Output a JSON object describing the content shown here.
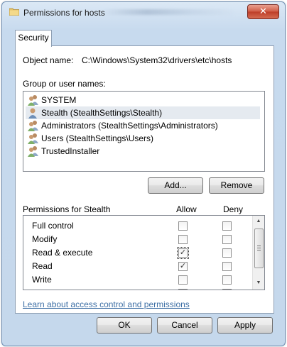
{
  "window": {
    "title": "Permissions for hosts",
    "close_glyph": "✕"
  },
  "tab": {
    "label": "Security"
  },
  "object": {
    "label": "Object name:",
    "value": "C:\\Windows\\System32\\drivers\\etc\\hosts"
  },
  "groups": {
    "label": "Group or user names:",
    "items": [
      {
        "label": "SYSTEM",
        "icon": "group-icon"
      },
      {
        "label": "Stealth (StealthSettings\\Stealth)",
        "icon": "user-icon",
        "selected": true
      },
      {
        "label": "Administrators (StealthSettings\\Administrators)",
        "icon": "group-icon"
      },
      {
        "label": "Users (StealthSettings\\Users)",
        "icon": "group-icon"
      },
      {
        "label": "TrustedInstaller",
        "icon": "group-icon"
      }
    ],
    "add_label": "Add...",
    "remove_label": "Remove"
  },
  "permissions": {
    "header": "Permissions for Stealth",
    "allow_header": "Allow",
    "deny_header": "Deny",
    "rows": [
      {
        "name": "Full control",
        "allow": false,
        "deny": false
      },
      {
        "name": "Modify",
        "allow": false,
        "deny": false
      },
      {
        "name": "Read & execute",
        "allow": true,
        "deny": false
      },
      {
        "name": "Read",
        "allow": true,
        "deny": false
      },
      {
        "name": "Write",
        "allow": false,
        "deny": false
      }
    ],
    "check_glyph": "✓"
  },
  "link": {
    "label": "Learn about access control and permissions"
  },
  "footer": {
    "ok_label": "OK",
    "cancel_label": "Cancel",
    "apply_label": "Apply"
  },
  "colors": {
    "link": "#3d6fa5",
    "selection": "#e5eaf0",
    "close_button": "#c9452f"
  }
}
